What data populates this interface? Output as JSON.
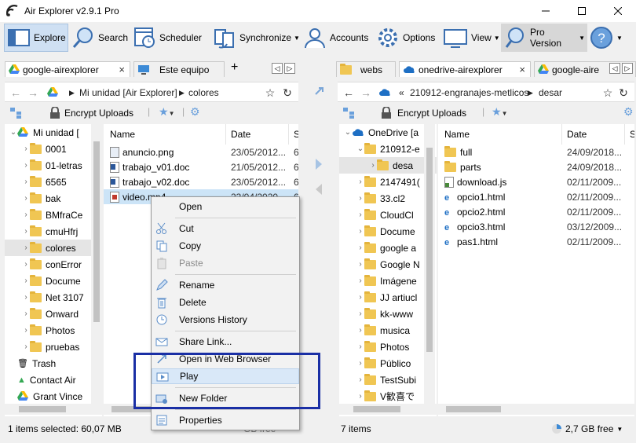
{
  "window": {
    "title": "Air Explorer v2.9.1 Pro"
  },
  "toolbar": {
    "explore": "Explore",
    "search": "Search",
    "scheduler": "Scheduler",
    "synchronize": "Synchronize",
    "accounts": "Accounts",
    "options": "Options",
    "view": "View",
    "pro": "Pro Version"
  },
  "left": {
    "tabs": [
      "google-airexplorer",
      "Este equipo"
    ],
    "add_tab": "+",
    "breadcrumb": [
      "Mi unidad [Air Explorer]",
      "colores"
    ],
    "encrypt_uploads": "Encrypt Uploads",
    "tree": [
      "Mi unidad [",
      "0001",
      "01-letras",
      "6565",
      "bak",
      "BMfraCe",
      "cmuHfrj",
      "colores",
      "conError",
      "Docume",
      "Net 3107",
      "Onward",
      "Photos",
      "pruebas",
      "Trash",
      "Contact Air",
      "Grant Vince"
    ],
    "columns": {
      "name": "Name",
      "date": "Date",
      "size": "S"
    },
    "files": [
      {
        "name": "anuncio.png",
        "date": "23/05/2012...",
        "extra": "6"
      },
      {
        "name": "trabajo_v01.doc",
        "date": "21/05/2012...",
        "extra": "6"
      },
      {
        "name": "trabajo_v02.doc",
        "date": "23/05/2012...",
        "extra": "6"
      },
      {
        "name": "video.mp4",
        "date": "23/04/2020...",
        "extra": "6"
      }
    ],
    "status": "1 items selected: 60,07 MB",
    "status_right": "GB free"
  },
  "right": {
    "tabs": [
      "webs",
      "onedrive-airexplorer",
      "google-aire"
    ],
    "breadcrumb": [
      "210912-engranajes-metlicos",
      "desar"
    ],
    "encrypt_uploads": "Encrypt Uploads",
    "tree": [
      "OneDrive [a",
      "210912-e",
      "desa",
      "2147491(",
      "33.cl2",
      "CloudCl",
      "Docume",
      "google a",
      "Google N",
      "Imágene",
      "JJ artiucl",
      "kk-www",
      "musica",
      "Photos",
      "Público",
      "TestSubi",
      "V歓喜で"
    ],
    "columns": {
      "name": "Name",
      "date": "Date",
      "size": "S"
    },
    "files": [
      {
        "name": "full",
        "date": "24/09/2018..."
      },
      {
        "name": "parts",
        "date": "24/09/2018..."
      },
      {
        "name": "download.js",
        "date": "02/11/2009..."
      },
      {
        "name": "opcio1.html",
        "date": "02/11/2009..."
      },
      {
        "name": "opcio2.html",
        "date": "02/11/2009..."
      },
      {
        "name": "opcio3.html",
        "date": "03/12/2009..."
      },
      {
        "name": "pas1.html",
        "date": "02/11/2009..."
      }
    ],
    "status": "7 items",
    "free": "2,7 GB free"
  },
  "context_menu": {
    "open": "Open",
    "cut": "Cut",
    "copy": "Copy",
    "paste": "Paste",
    "rename": "Rename",
    "delete": "Delete",
    "versions": "Versions History",
    "share": "Share Link...",
    "web": "Open in Web Browser",
    "play": "Play",
    "new_folder": "New Folder",
    "properties": "Properties"
  }
}
